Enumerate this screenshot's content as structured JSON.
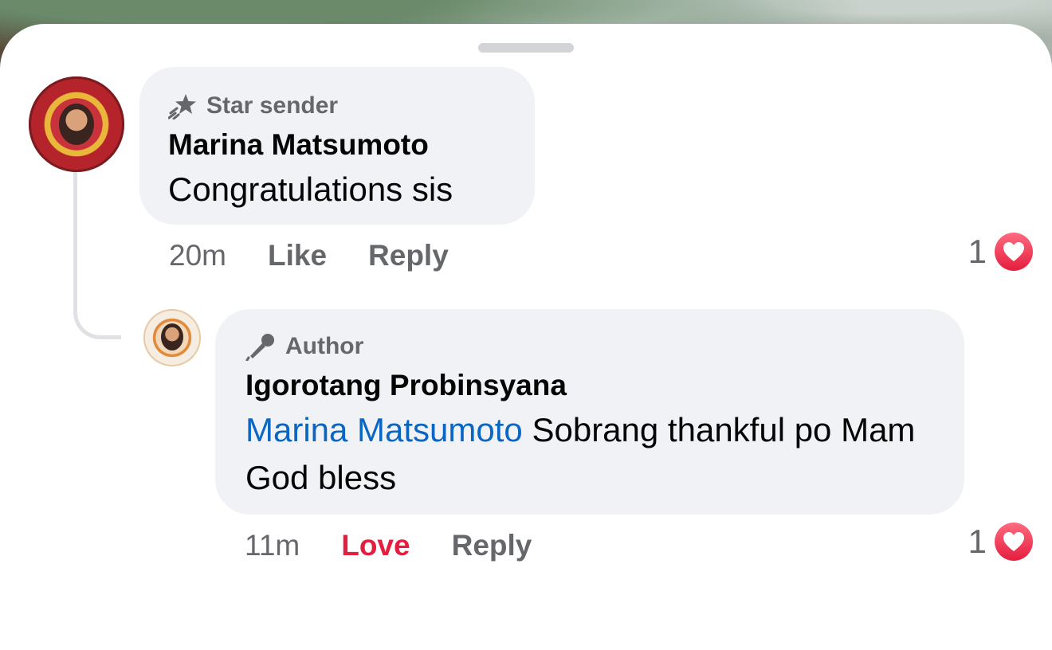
{
  "comments": [
    {
      "badge": "Star sender",
      "badge_icon": "star-sender-icon",
      "name": "Marina Matsumoto",
      "text": "Congratulations sis",
      "time": "20m",
      "action_primary": "Like",
      "action_reply": "Reply",
      "reaction_count": "1",
      "reaction_icon": "heart-icon"
    },
    {
      "badge": "Author",
      "badge_icon": "microphone-icon",
      "name": "Igorotang Probinsyana",
      "mention": "Marina Matsumoto",
      "text": " Sobrang thankful po Mam God bless",
      "time": "11m",
      "action_primary": "Love",
      "action_reply": "Reply",
      "reaction_count": "1",
      "reaction_icon": "heart-icon"
    }
  ],
  "colors": {
    "bubble": "#f0f2f5",
    "meta": "#65676b",
    "mention": "#0a66c2",
    "love": "#e41e3f"
  }
}
